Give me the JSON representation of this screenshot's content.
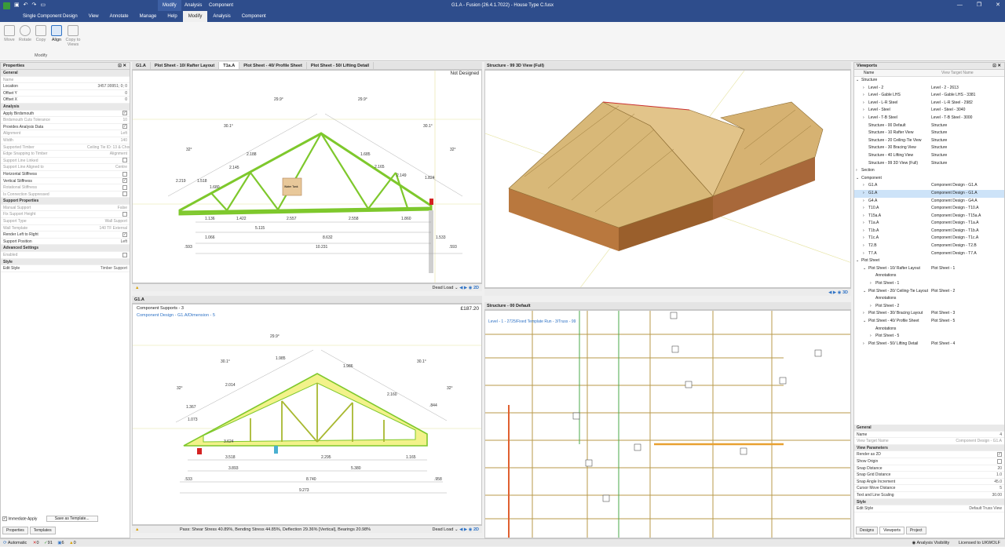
{
  "app": {
    "title": "G1.A - Fusion (26.4.1.7022) - House Type C.fusx",
    "context_tabs": [
      "Modify",
      "Analysis",
      "Component"
    ]
  },
  "menu": {
    "items": [
      "Single Component Design",
      "View",
      "Annotate",
      "Manage",
      "Help",
      "Modify",
      "Analysis",
      "Component"
    ]
  },
  "ribbon": {
    "tools": [
      "Move",
      "Rotate",
      "Copy",
      "Align",
      "Copy to Views"
    ],
    "group_label": "Modify"
  },
  "properties": {
    "title": "Properties",
    "rows": [
      {
        "k": "General",
        "v": "",
        "type": "sec"
      },
      {
        "k": "Name",
        "v": "",
        "type": "dim"
      },
      {
        "k": "Location",
        "v": "3457.99951; 0; 0",
        "type": ""
      },
      {
        "k": "Offset Y",
        "v": "0",
        "type": ""
      },
      {
        "k": "Offset X",
        "v": "0",
        "type": ""
      },
      {
        "k": "Analysis",
        "v": "",
        "type": "sec"
      },
      {
        "k": "Apply Birdsmouth",
        "v": "✓",
        "type": "chk"
      },
      {
        "k": "Birdsmouth Cuts Tolerance",
        "v": "10",
        "type": "dim"
      },
      {
        "k": "Provides Analysis Data",
        "v": "✓",
        "type": "chk"
      },
      {
        "k": "Alignment",
        "v": "Left",
        "type": "dim"
      },
      {
        "k": "Width",
        "v": "140",
        "type": "dim"
      },
      {
        "k": "Supported Timber",
        "v": "Ceiling Tie ID: 13 & Chord: 7",
        "type": "dim"
      },
      {
        "k": "Edge Snapping to Timber",
        "v": "Alignment",
        "type": "dim"
      },
      {
        "k": "Support Line Linked",
        "v": "",
        "type": "dimchk"
      },
      {
        "k": "Support Line Aligned to",
        "v": "Centre",
        "type": "dim"
      },
      {
        "k": "Horizontal Stiffness",
        "v": "",
        "type": "chk"
      },
      {
        "k": "Vertical Stiffness",
        "v": "✓",
        "type": "chk"
      },
      {
        "k": "Rotational Stiffness",
        "v": "",
        "type": "dimchk"
      },
      {
        "k": "Is Connection Suppressed",
        "v": "",
        "type": "dimchk"
      },
      {
        "k": "Support Properties",
        "v": "",
        "type": "sec"
      },
      {
        "k": "Manual Support",
        "v": "False",
        "type": "dim"
      },
      {
        "k": "Fix Support Height",
        "v": "",
        "type": "dimchk"
      },
      {
        "k": "Support Type",
        "v": "Wall Support",
        "type": "dim"
      },
      {
        "k": "Wall Template",
        "v": "140 TF External",
        "type": "dim"
      },
      {
        "k": "Render Left to Right",
        "v": "✓",
        "type": "chk"
      },
      {
        "k": "Support Position",
        "v": "Left",
        "type": ""
      },
      {
        "k": "Advanced Settings",
        "v": "",
        "type": "sec"
      },
      {
        "k": "Enabled",
        "v": "",
        "type": "dimchk"
      },
      {
        "k": "Style",
        "v": "",
        "type": "sec"
      },
      {
        "k": "Edit Style",
        "v": "Timber Support",
        "type": ""
      }
    ],
    "immediate_apply": "Immediate Apply",
    "save_template": "Save as Template...",
    "bottom_tabs": [
      "Properties",
      "Templates"
    ]
  },
  "view_tl": {
    "tabs": [
      "G1.A",
      "Plot Sheet - 10/ Rafter Layout",
      "T1a.A",
      "Plot Sheet - 40/ Profile Sheet",
      "Plot Sheet - 50/ Lifting Detail"
    ],
    "status": "Not Designed",
    "load": "Dead Load",
    "mode": "2D",
    "dims_bottom": [
      "1.136",
      "1.422",
      "2.557",
      "2.558",
      "1.860",
      "5.115",
      "8.632",
      "10.231",
      "1.066",
      ".593",
      ".593",
      "1.533"
    ],
    "dims_top": [
      "2.219",
      "2.188",
      "2.145",
      "1.680",
      "1.518",
      "1.685",
      "2.165",
      "2.149",
      "1.824"
    ],
    "angles": [
      "29.9°",
      "29.9°",
      "30.1°",
      "30.1°",
      "32°",
      "32°"
    ],
    "label_box": "Water Tank"
  },
  "view_bl": {
    "header": "G1.A",
    "line1": "Component Supports - 3",
    "line2": "Component Design - G1.A/Dimension - 5",
    "price": "£187.20",
    "footer": "Pass: Shear Stress 40.89%, Bending Stress 44.85%, Deflection 29.36% [Vertical], Bearings 20.98%",
    "load": "Dead Load",
    "mode": "2D",
    "dims": [
      "3.518",
      "2.295",
      "1.165",
      "3.893",
      "8.740",
      "9.273",
      "5.380",
      ".958",
      ".533"
    ],
    "dims_top": [
      "1.985",
      "1.986",
      "2.014",
      "2.160",
      "1.367",
      "1.073",
      ".844"
    ],
    "angles": [
      "29.9°",
      "30.1°",
      "30.1°",
      "32°",
      "32°"
    ],
    "label": "3.624"
  },
  "view_tr": {
    "header": "Structure - 99 3D View (Full)",
    "mode": "3D"
  },
  "view_br": {
    "header": "Structure - 00 Default",
    "caption": "Level - 1 - 2725/Fixed Template Run - 3/Truss - 99"
  },
  "viewports": {
    "title": "Viewports",
    "col1": "Name",
    "col2": "View Target Name",
    "nodes": [
      {
        "a": "Structure",
        "b": "",
        "ind": 0,
        "exp": "⌄"
      },
      {
        "a": "Level - 2",
        "b": "Level - 2 - 2613",
        "ind": 1,
        "exp": "›"
      },
      {
        "a": "Level - Gable LHS",
        "b": "Level - Gable LHS - 3381",
        "ind": 1,
        "exp": "›"
      },
      {
        "a": "Level - L-R Steel",
        "b": "Level - L-R Steel - 2982",
        "ind": 1,
        "exp": "›"
      },
      {
        "a": "Level - Steel",
        "b": "Level - Steel - 3040",
        "ind": 1,
        "exp": "›"
      },
      {
        "a": "Level - T-B Steel",
        "b": "Level - T-B Steel - 3000",
        "ind": 1,
        "exp": "›"
      },
      {
        "a": "Structure - 00 Default",
        "b": "Structure",
        "ind": 1,
        "exp": ""
      },
      {
        "a": "Structure - 10 Rafter View",
        "b": "Structure",
        "ind": 1,
        "exp": ""
      },
      {
        "a": "Structure - 20 Ceiling-Tie View",
        "b": "Structure",
        "ind": 1,
        "exp": ""
      },
      {
        "a": "Structure - 30 Bracing View",
        "b": "Structure",
        "ind": 1,
        "exp": ""
      },
      {
        "a": "Structure - 40 Lifting View",
        "b": "Structure",
        "ind": 1,
        "exp": ""
      },
      {
        "a": "Structure - 99 3D View (Full)",
        "b": "Structure",
        "ind": 1,
        "exp": ""
      },
      {
        "a": "Section",
        "b": "",
        "ind": 0,
        "exp": "›"
      },
      {
        "a": "Component",
        "b": "",
        "ind": 0,
        "exp": "⌄"
      },
      {
        "a": "G1.A",
        "b": "Component Design - G1.A",
        "ind": 1,
        "exp": "›"
      },
      {
        "a": "G1.A",
        "b": "Component Design - G1.A",
        "ind": 1,
        "exp": "›",
        "sel": true
      },
      {
        "a": "G4.A",
        "b": "Component Design - G4.A",
        "ind": 1,
        "exp": "›"
      },
      {
        "a": "T10.A",
        "b": "Component Design - T10.A",
        "ind": 1,
        "exp": "›"
      },
      {
        "a": "T15a.A",
        "b": "Component Design - T15a.A",
        "ind": 1,
        "exp": "›"
      },
      {
        "a": "T1a.A",
        "b": "Component Design - T1a.A",
        "ind": 1,
        "exp": "›"
      },
      {
        "a": "T1b.A",
        "b": "Component Design - T1b.A",
        "ind": 1,
        "exp": "›"
      },
      {
        "a": "T1c.A",
        "b": "Component Design - T1c.A",
        "ind": 1,
        "exp": "›"
      },
      {
        "a": "T2.B",
        "b": "Component Design - T2.B",
        "ind": 1,
        "exp": "›"
      },
      {
        "a": "T7.A",
        "b": "Component Design - T7.A",
        "ind": 1,
        "exp": "›"
      },
      {
        "a": "Plot Sheet",
        "b": "",
        "ind": 0,
        "exp": "⌄"
      },
      {
        "a": "Plot Sheet - 10/ Rafter Layout",
        "b": "Plot Sheet - 1",
        "ind": 1,
        "exp": "⌄"
      },
      {
        "a": "Annotations",
        "b": "",
        "ind": 2,
        "exp": ""
      },
      {
        "a": "Plot Sheet - 1",
        "b": "",
        "ind": 2,
        "exp": "›"
      },
      {
        "a": "Plot Sheet - 20/ Ceiling-Tie Layout",
        "b": "Plot Sheet - 2",
        "ind": 1,
        "exp": "⌄"
      },
      {
        "a": "Annotations",
        "b": "",
        "ind": 2,
        "exp": ""
      },
      {
        "a": "Plot Sheet - 2",
        "b": "",
        "ind": 2,
        "exp": "›"
      },
      {
        "a": "Plot Sheet - 30/ Bracing Layout",
        "b": "Plot Sheet - 3",
        "ind": 1,
        "exp": "›"
      },
      {
        "a": "Plot Sheet - 40/ Profile Sheet",
        "b": "Plot Sheet - 5",
        "ind": 1,
        "exp": "⌄"
      },
      {
        "a": "Annotations",
        "b": "",
        "ind": 2,
        "exp": ""
      },
      {
        "a": "Plot Sheet - 5",
        "b": "",
        "ind": 2,
        "exp": "›"
      },
      {
        "a": "Plot Sheet - 50/ Lifting Detail",
        "b": "Plot Sheet - 4",
        "ind": 1,
        "exp": "›"
      }
    ],
    "props": [
      {
        "k": "General",
        "v": "",
        "type": "sec"
      },
      {
        "k": "Name",
        "v": "4",
        "type": ""
      },
      {
        "k": "View Target Name",
        "v": "Component Design - G1.A",
        "type": "dim"
      },
      {
        "k": "View Parameters",
        "v": "",
        "type": "sec"
      },
      {
        "k": "Render as 2D",
        "v": "✓",
        "type": "chk"
      },
      {
        "k": "Show Origin",
        "v": "",
        "type": "chk"
      },
      {
        "k": "Snap Distance",
        "v": "20",
        "type": ""
      },
      {
        "k": "Snap Grid Distance",
        "v": "1.0",
        "type": ""
      },
      {
        "k": "Snap Angle Increment",
        "v": "45.0",
        "type": ""
      },
      {
        "k": "Cursor Move Distance",
        "v": "5",
        "type": ""
      },
      {
        "k": "Text and Line Scaling",
        "v": "30.00",
        "type": ""
      },
      {
        "k": "Style",
        "v": "",
        "type": "sec"
      },
      {
        "k": "Edit Style",
        "v": "Default Truss View",
        "type": ""
      }
    ],
    "bottom_tabs": [
      "Designs",
      "Viewports",
      "Project"
    ]
  },
  "status": {
    "mode": "Automatic",
    "errors": "0",
    "ok": "91",
    "info": "6",
    "warn": "0",
    "analysis": "Analysis Visibility",
    "license": "Licensed to UKWOLF"
  }
}
